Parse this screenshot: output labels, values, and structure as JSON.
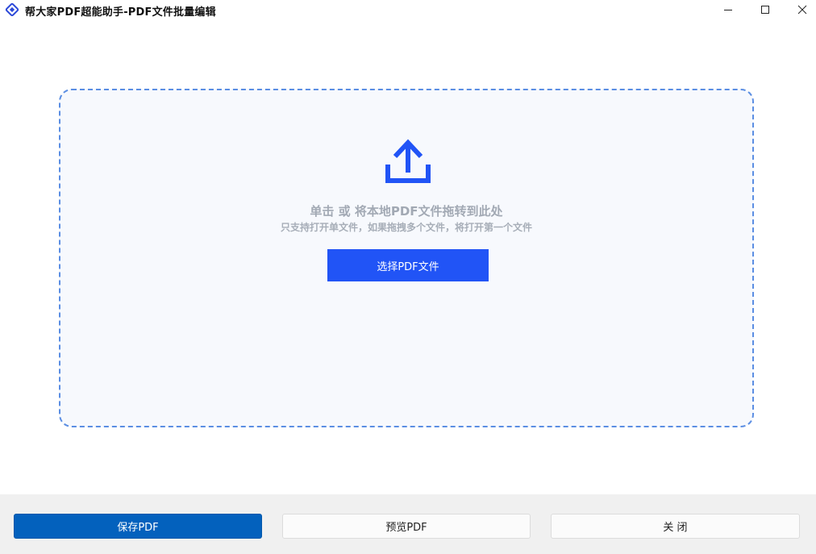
{
  "window": {
    "title": "帮大家PDF超能助手-PDF文件批量编辑",
    "controls": [
      "minimize-icon",
      "maximize-icon",
      "close-icon"
    ]
  },
  "dropzone": {
    "icon": "upload-icon",
    "main_text": "单击 或 将本地PDF文件拖转到此处",
    "sub_text": "只支持打开单文件，如果拖拽多个文件，将打开第一个文件",
    "select_button": "选择PDF文件"
  },
  "footer": {
    "save_label": "保存PDF",
    "preview_label": "预览PDF",
    "close_label": "关 闭"
  },
  "colors": {
    "accent": "#2154f6",
    "save_button": "#0361bd",
    "dropzone_border": "#5b8ee3",
    "dropzone_bg": "#f7f9fd"
  }
}
